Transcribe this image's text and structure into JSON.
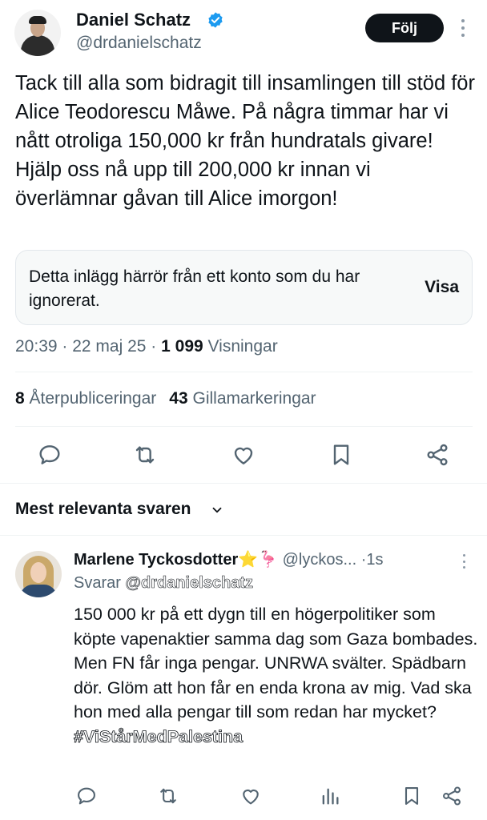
{
  "tweet": {
    "author_name": "Daniel Schatz",
    "author_handle": "@drdanielschatz",
    "follow_label": "Följ",
    "text": "Tack till alla som bidragit till insamlingen till stöd för Alice Teodorescu Måwe. På några timmar har vi nått otroliga 150,000 kr från hundratals givare! Hjälp oss nå upp till 200,000 kr innan vi överlämnar gåvan till Alice imorgon!",
    "ignored_notice": "Detta inlägg härrör från ett konto som du har ignorerat.",
    "ignored_show_label": "Visa",
    "time": "20:39",
    "date": "22 maj 25",
    "views_count": "1 099",
    "views_label": "Visningar",
    "reposts_count": "8",
    "reposts_label": "Återpubliceringar",
    "likes_count": "43",
    "likes_label": "Gillamarkeringar"
  },
  "replies_section": {
    "title": "Mest relevanta svaren"
  },
  "reply": {
    "name": "Marlene Tyckosdotter",
    "emoji": "⭐🦩",
    "handle": "@lyckos...",
    "time": "1s",
    "replying_prefix": "Svarar",
    "replying_to": "@drdanielschatz",
    "text": "150 000 kr på ett dygn till en högerpolitiker som köpte vapenaktier samma dag som Gaza bombades.\nMen FN får inga pengar. UNRWA svälter. Spädbarn dör. Glöm att hon får en enda krona av mig. Vad ska hon med alla pengar till som redan har mycket?",
    "hashtag": "#ViStårMedPalestina"
  },
  "icons": {
    "verified": "verified-badge-icon",
    "reply": "reply-icon",
    "repost": "repost-icon",
    "like": "like-icon",
    "bookmark": "bookmark-icon",
    "share": "share-icon",
    "views": "views-icon",
    "chevron": "chevron-down-icon",
    "more": "more-icon"
  },
  "colors": {
    "text": "#0f1419",
    "secondary": "#536471",
    "verified": "#1d9bf0",
    "button_bg": "#0f1419"
  }
}
